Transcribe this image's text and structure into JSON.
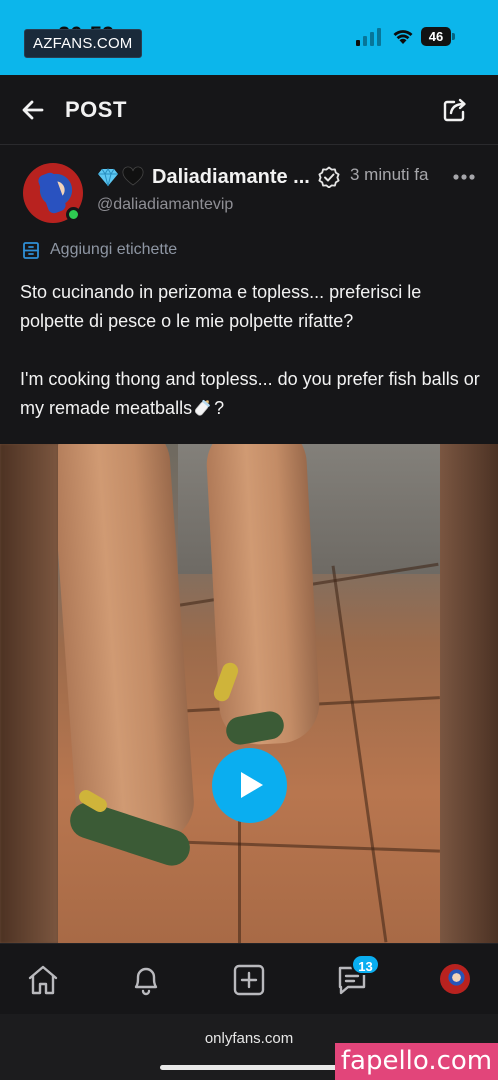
{
  "status_bar": {
    "time": "20:59",
    "watermark": "AZFANS.COM",
    "battery": "46"
  },
  "header": {
    "title": "POST"
  },
  "post": {
    "display_name": "Daliadiamante ...",
    "handle": "@daliadiamantevip",
    "time_ago": "3 minuti fa",
    "tag_label": "Aggiungi etichette",
    "caption_it": "Sto cucinando in perizoma e topless... preferisci le polpette di pesce o le mie polpette rifatte?",
    "caption_en": "I'm cooking thong and topless... do you prefer fish balls or my remade meatballs",
    "caption_en_end": "?",
    "icons": [
      "gem-icon",
      "black-heart-icon",
      "verified-icon",
      "more-icon",
      "tag-icon",
      "baby-bottle-icon"
    ]
  },
  "media": {
    "type": "video",
    "play_icon": "play-icon"
  },
  "bottom_nav": {
    "items": [
      "home-icon",
      "bell-icon",
      "add-icon",
      "messages-icon",
      "profile-avatar"
    ],
    "messages_badge": "13"
  },
  "browser": {
    "url": "onlyfans.com"
  },
  "watermark_bottom": "fapello.com",
  "colors": {
    "status_bar": "#0cb6eb",
    "background": "#161618",
    "accent": "#0aaef0",
    "online": "#2ecc52",
    "watermark_bg": "#e2457a"
  }
}
